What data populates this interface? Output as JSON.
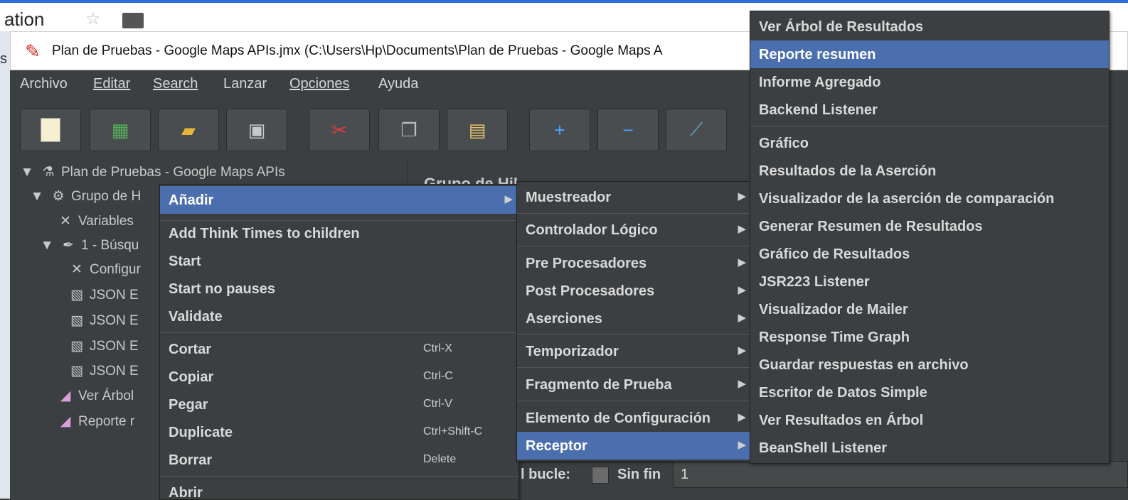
{
  "browser": {
    "partial_title": "ation"
  },
  "window": {
    "title": "Plan de Pruebas - Google Maps APIs.jmx (C:\\Users\\Hp\\Documents\\Plan de Pruebas - Google Maps A"
  },
  "menubar": [
    "Archivo",
    "Editar",
    "Search",
    "Lanzar",
    "Opciones",
    "Ayuda"
  ],
  "toolbar": {
    "icons": [
      "new-icon",
      "templates-icon",
      "open-icon",
      "save-icon",
      "cut-icon",
      "copy-icon",
      "paste-icon",
      "expand-icon",
      "collapse-icon",
      "toggle-icon"
    ]
  },
  "tree": {
    "root": "Plan de Pruebas - Google Maps APIs",
    "items": [
      "Grupo de H",
      "Variables",
      "1 - Búsqu",
      "Configur",
      "JSON E",
      "JSON E",
      "JSON E",
      "JSON E",
      "Ver Árbol",
      "Reporte r"
    ]
  },
  "right_panel": {
    "title": "Grupo de Hil"
  },
  "context_menu": {
    "items": [
      {
        "label": "Añadir",
        "arrow": "▶"
      },
      {
        "label": "Add Think Times to children"
      },
      {
        "label": "Start"
      },
      {
        "label": "Start no pauses"
      },
      {
        "label": "Validate"
      },
      {
        "label": "Cortar",
        "shortcut": "Ctrl-X"
      },
      {
        "label": "Copiar",
        "shortcut": "Ctrl-C"
      },
      {
        "label": "Pegar",
        "shortcut": "Ctrl-V"
      },
      {
        "label": "Duplicate",
        "shortcut": "Ctrl+Shift-C"
      },
      {
        "label": "Borrar",
        "shortcut": "Delete"
      },
      {
        "label": "Abrir"
      }
    ]
  },
  "submenu_anadir": {
    "items": [
      {
        "label": "Muestreador"
      },
      {
        "label": "Controlador Lógico"
      },
      {
        "label": "Pre Procesadores"
      },
      {
        "label": "Post Procesadores"
      },
      {
        "label": "Aserciones"
      },
      {
        "label": "Temporizador"
      },
      {
        "label": "Fragmento de Prueba"
      },
      {
        "label": "Elemento de Configuración"
      },
      {
        "label": "Receptor"
      }
    ]
  },
  "submenu_receptor": {
    "items": [
      "Ver Árbol de Resultados",
      "Reporte resumen",
      "Informe Agregado",
      "Backend Listener",
      "Gráfico",
      "Resultados de la Aserción",
      "Visualizador de la aserción de comparación",
      "Generar Resumen de Resultados",
      "Gráfico de Resultados",
      "JSR223 Listener",
      "Visualizador de Mailer",
      "Response Time Graph",
      "Guardar respuestas en archivo",
      "Escritor de Datos Simple",
      "Ver Resultados en Árbol",
      "BeanShell Listener"
    ]
  },
  "loop_bar": {
    "label": "l bucle:",
    "forever_label": "Sin fin",
    "value": "1"
  },
  "colors": {
    "selection": "#4b6eaf",
    "background": "#3c3f41",
    "browser_accent": "#2b6fd6"
  }
}
